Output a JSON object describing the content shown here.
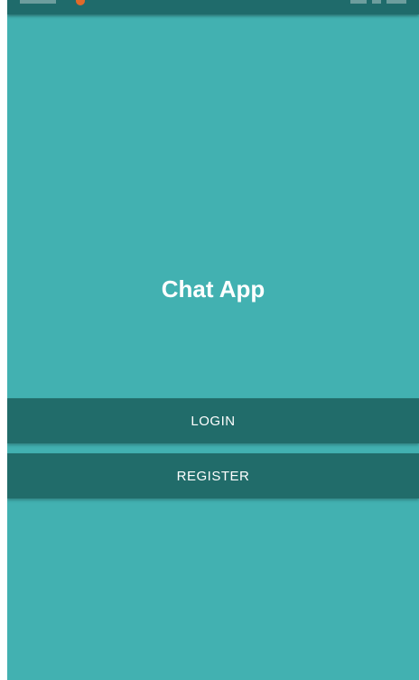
{
  "app": {
    "title": "Chat App"
  },
  "buttons": {
    "login_label": "LOGIN",
    "register_label": "REGISTER"
  },
  "colors": {
    "background": "#42b1b1",
    "button": "#216c6a",
    "status_bar": "#1f6b6b",
    "text": "#ffffff"
  }
}
